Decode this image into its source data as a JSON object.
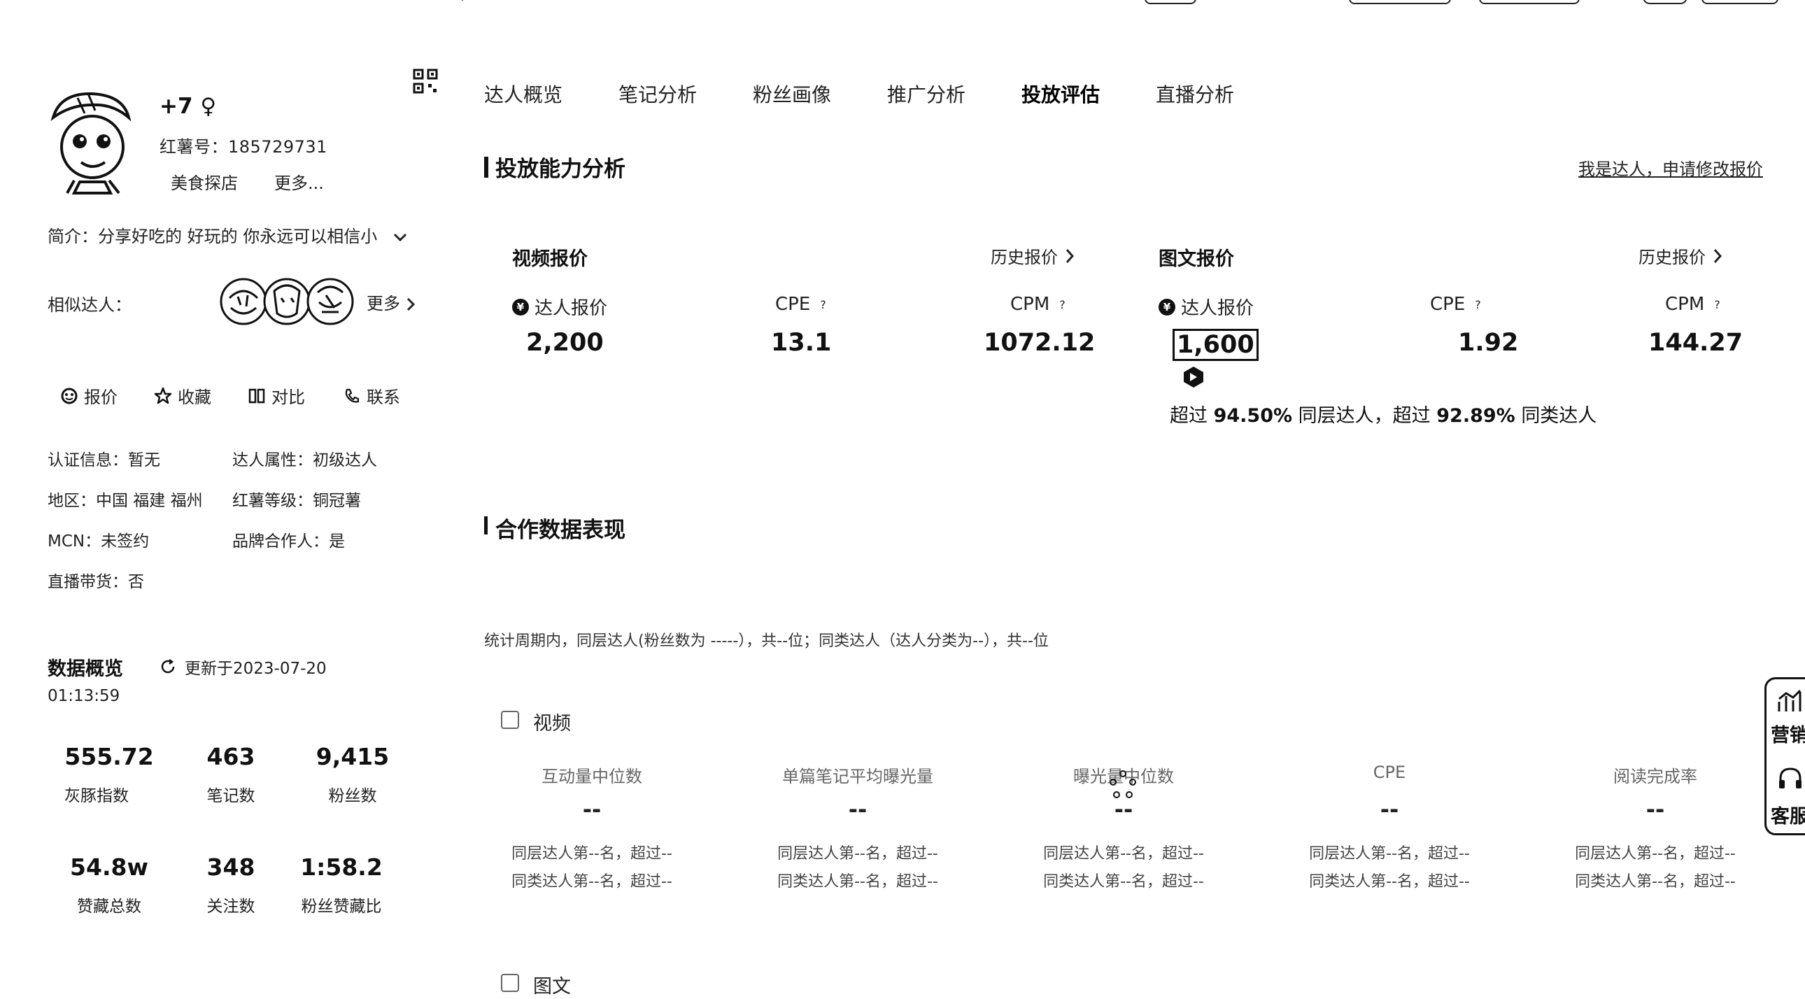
{
  "profile": {
    "name": "+7 ♀",
    "red_id": "红薯号：185729731",
    "tags": [
      "美食探店",
      "更多..."
    ],
    "intro": "简介：分享好吃的 好玩的 你永远可以相信小",
    "similar_label": "相似达人：",
    "similar_more": "更多",
    "actions": [
      "报价",
      "收藏",
      "对比",
      "联系"
    ],
    "info": {
      "certification": "认证信息：暂无",
      "attribute": "达人属性：初级达人",
      "region": "地区：中国 福建 福州",
      "level": "红薯等级：铜冠薯",
      "mcn": "MCN：未签约",
      "brand_partner": "品牌合作人：是",
      "live_selling": "直播带货：否"
    }
  },
  "overview": {
    "title": "数据概览",
    "updated": "更新于2023-07-20",
    "updated_time": "01:13:59",
    "stats": [
      {
        "value": "555.72",
        "label": "灰豚指数"
      },
      {
        "value": "463",
        "label": "笔记数"
      },
      {
        "value": "9,415",
        "label": "粉丝数"
      },
      {
        "value": "54.8w",
        "label": "赞藏总数"
      },
      {
        "value": "348",
        "label": "关注数"
      },
      {
        "value": "1:58.2",
        "label": "粉丝赞藏比"
      }
    ]
  },
  "tabs": [
    "达人概览",
    "笔记分析",
    "粉丝画像",
    "推广分析",
    "投放评估",
    "直播分析"
  ],
  "active_tab": "投放评估",
  "delivery": {
    "title": "投放能力分析",
    "apply_link": "我是达人，申请修改报价",
    "video": {
      "title": "视频报价",
      "history": "历史报价",
      "labels": [
        "达人报价",
        "CPE",
        "CPM"
      ],
      "values": [
        "2,200",
        "13.1",
        "1072.12"
      ]
    },
    "image_text": {
      "title": "图文报价",
      "history": "历史报价",
      "labels": [
        "达人报价",
        "CPE",
        "CPM"
      ],
      "values": [
        "1,600",
        "1.92",
        "144.27"
      ]
    },
    "exceed_prefix": "超过",
    "exceed_peer_pct": "94.50%",
    "exceed_peer_suffix": "同层达人，超过",
    "exceed_cat_pct": "92.89%",
    "exceed_cat_suffix": "同类达人"
  },
  "cooperation": {
    "title": "合作数据表现",
    "note": "统计周期内，同层达人(粉丝数为 -----），共--位；同类达人（达人分类为--），共--位",
    "video_label": "视频",
    "image_label": "图文",
    "headers": [
      "互动量中位数",
      "单篇笔记平均曝光量",
      "曝光量中位数",
      "CPE",
      "阅读完成率"
    ],
    "value": "--",
    "rank_peer": "同层达人第--名，超过--",
    "rank_cat": "同类达人第--名，超过--"
  },
  "float_widget": {
    "items": [
      "营销",
      "客服"
    ]
  },
  "colors": {
    "text": "#111111",
    "muted": "#222222",
    "background": "#ffffff"
  }
}
